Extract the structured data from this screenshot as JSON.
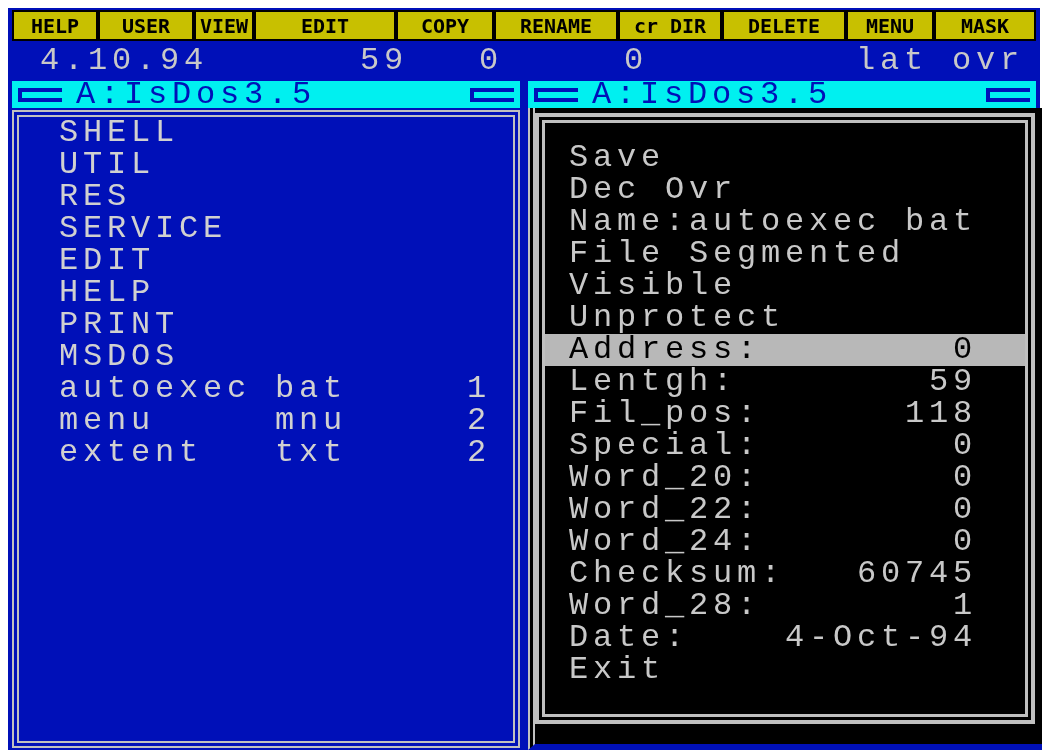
{
  "function_keys": [
    "HELP",
    "USER",
    "VIEW",
    "EDIT",
    "COPY",
    "RENAME",
    "cr DIR",
    "DELETE",
    "MENU",
    "MASK"
  ],
  "status_bar": {
    "date": "4.10.94",
    "values": [
      "59",
      "0",
      "0"
    ],
    "mode": "lat ovr"
  },
  "panels": [
    {
      "title": "A:IsDos3.5",
      "items": [
        {
          "kind": "dir",
          "name": "SHELL"
        },
        {
          "kind": "dir",
          "name": "UTIL"
        },
        {
          "kind": "dir",
          "name": "RES"
        },
        {
          "kind": "dir",
          "name": "SERVICE"
        },
        {
          "kind": "dir",
          "name": "EDIT"
        },
        {
          "kind": "dir",
          "name": "HELP"
        },
        {
          "kind": "dir",
          "name": "PRINT"
        },
        {
          "kind": "dir",
          "name": "MSDOS"
        },
        {
          "kind": "file",
          "name": "autoexec",
          "ext": "bat",
          "size": "1"
        },
        {
          "kind": "file",
          "name": "menu",
          "ext": "mnu",
          "size": "2"
        },
        {
          "kind": "file",
          "name": "extent",
          "ext": "txt",
          "size": "2"
        }
      ]
    },
    {
      "title": "A:IsDos3.5"
    }
  ],
  "dialog": {
    "items": [
      {
        "kind": "action",
        "text": "Save",
        "selected": false
      },
      {
        "kind": "action",
        "text": "Dec Ovr",
        "selected": false
      },
      {
        "kind": "action",
        "text": "Name:autoexec bat",
        "selected": false
      },
      {
        "kind": "action",
        "text": "File Segmented",
        "selected": false
      },
      {
        "kind": "action",
        "text": "Visible",
        "selected": false
      },
      {
        "kind": "action",
        "text": "Unprotect",
        "selected": false
      },
      {
        "kind": "field",
        "label": "Address:",
        "value": "0",
        "selected": true
      },
      {
        "kind": "field",
        "label": "Lentgh:",
        "value": "59",
        "selected": false
      },
      {
        "kind": "field",
        "label": "Fil_pos:",
        "value": "118",
        "selected": false
      },
      {
        "kind": "field",
        "label": "Special:",
        "value": "0",
        "selected": false
      },
      {
        "kind": "field",
        "label": "Word_20:",
        "value": "0",
        "selected": false
      },
      {
        "kind": "field",
        "label": "Word_22:",
        "value": "0",
        "selected": false
      },
      {
        "kind": "field",
        "label": "Word_24:",
        "value": "0",
        "selected": false
      },
      {
        "kind": "field",
        "label": "Checksum:",
        "value": "60745",
        "selected": false
      },
      {
        "kind": "field",
        "label": "Word_28:",
        "value": "1",
        "selected": false
      },
      {
        "kind": "field",
        "label": "Date:",
        "value": "4-Oct-94",
        "selected": false
      },
      {
        "kind": "action",
        "text": "Exit",
        "selected": false
      }
    ]
  }
}
